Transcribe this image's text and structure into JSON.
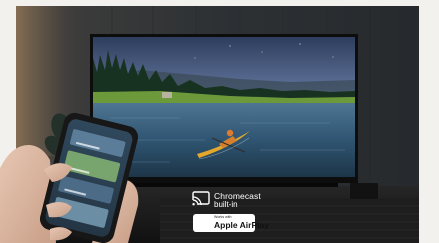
{
  "badges": {
    "chromecast": {
      "line1": "Chromecast",
      "line2": "built-in",
      "icon": "chromecast-icon"
    },
    "airplay": {
      "small_text": "Works with",
      "label": "Apple AirPlay",
      "icon": "airplay-icon"
    }
  },
  "colors": {
    "wall": "#2e3134",
    "frame_background": "#f3f1ed",
    "sky": "#6f86ad",
    "water": "#2f5572",
    "kayak": "#e3a72c",
    "floor": "#1a1a1a",
    "phone": "#171717"
  }
}
